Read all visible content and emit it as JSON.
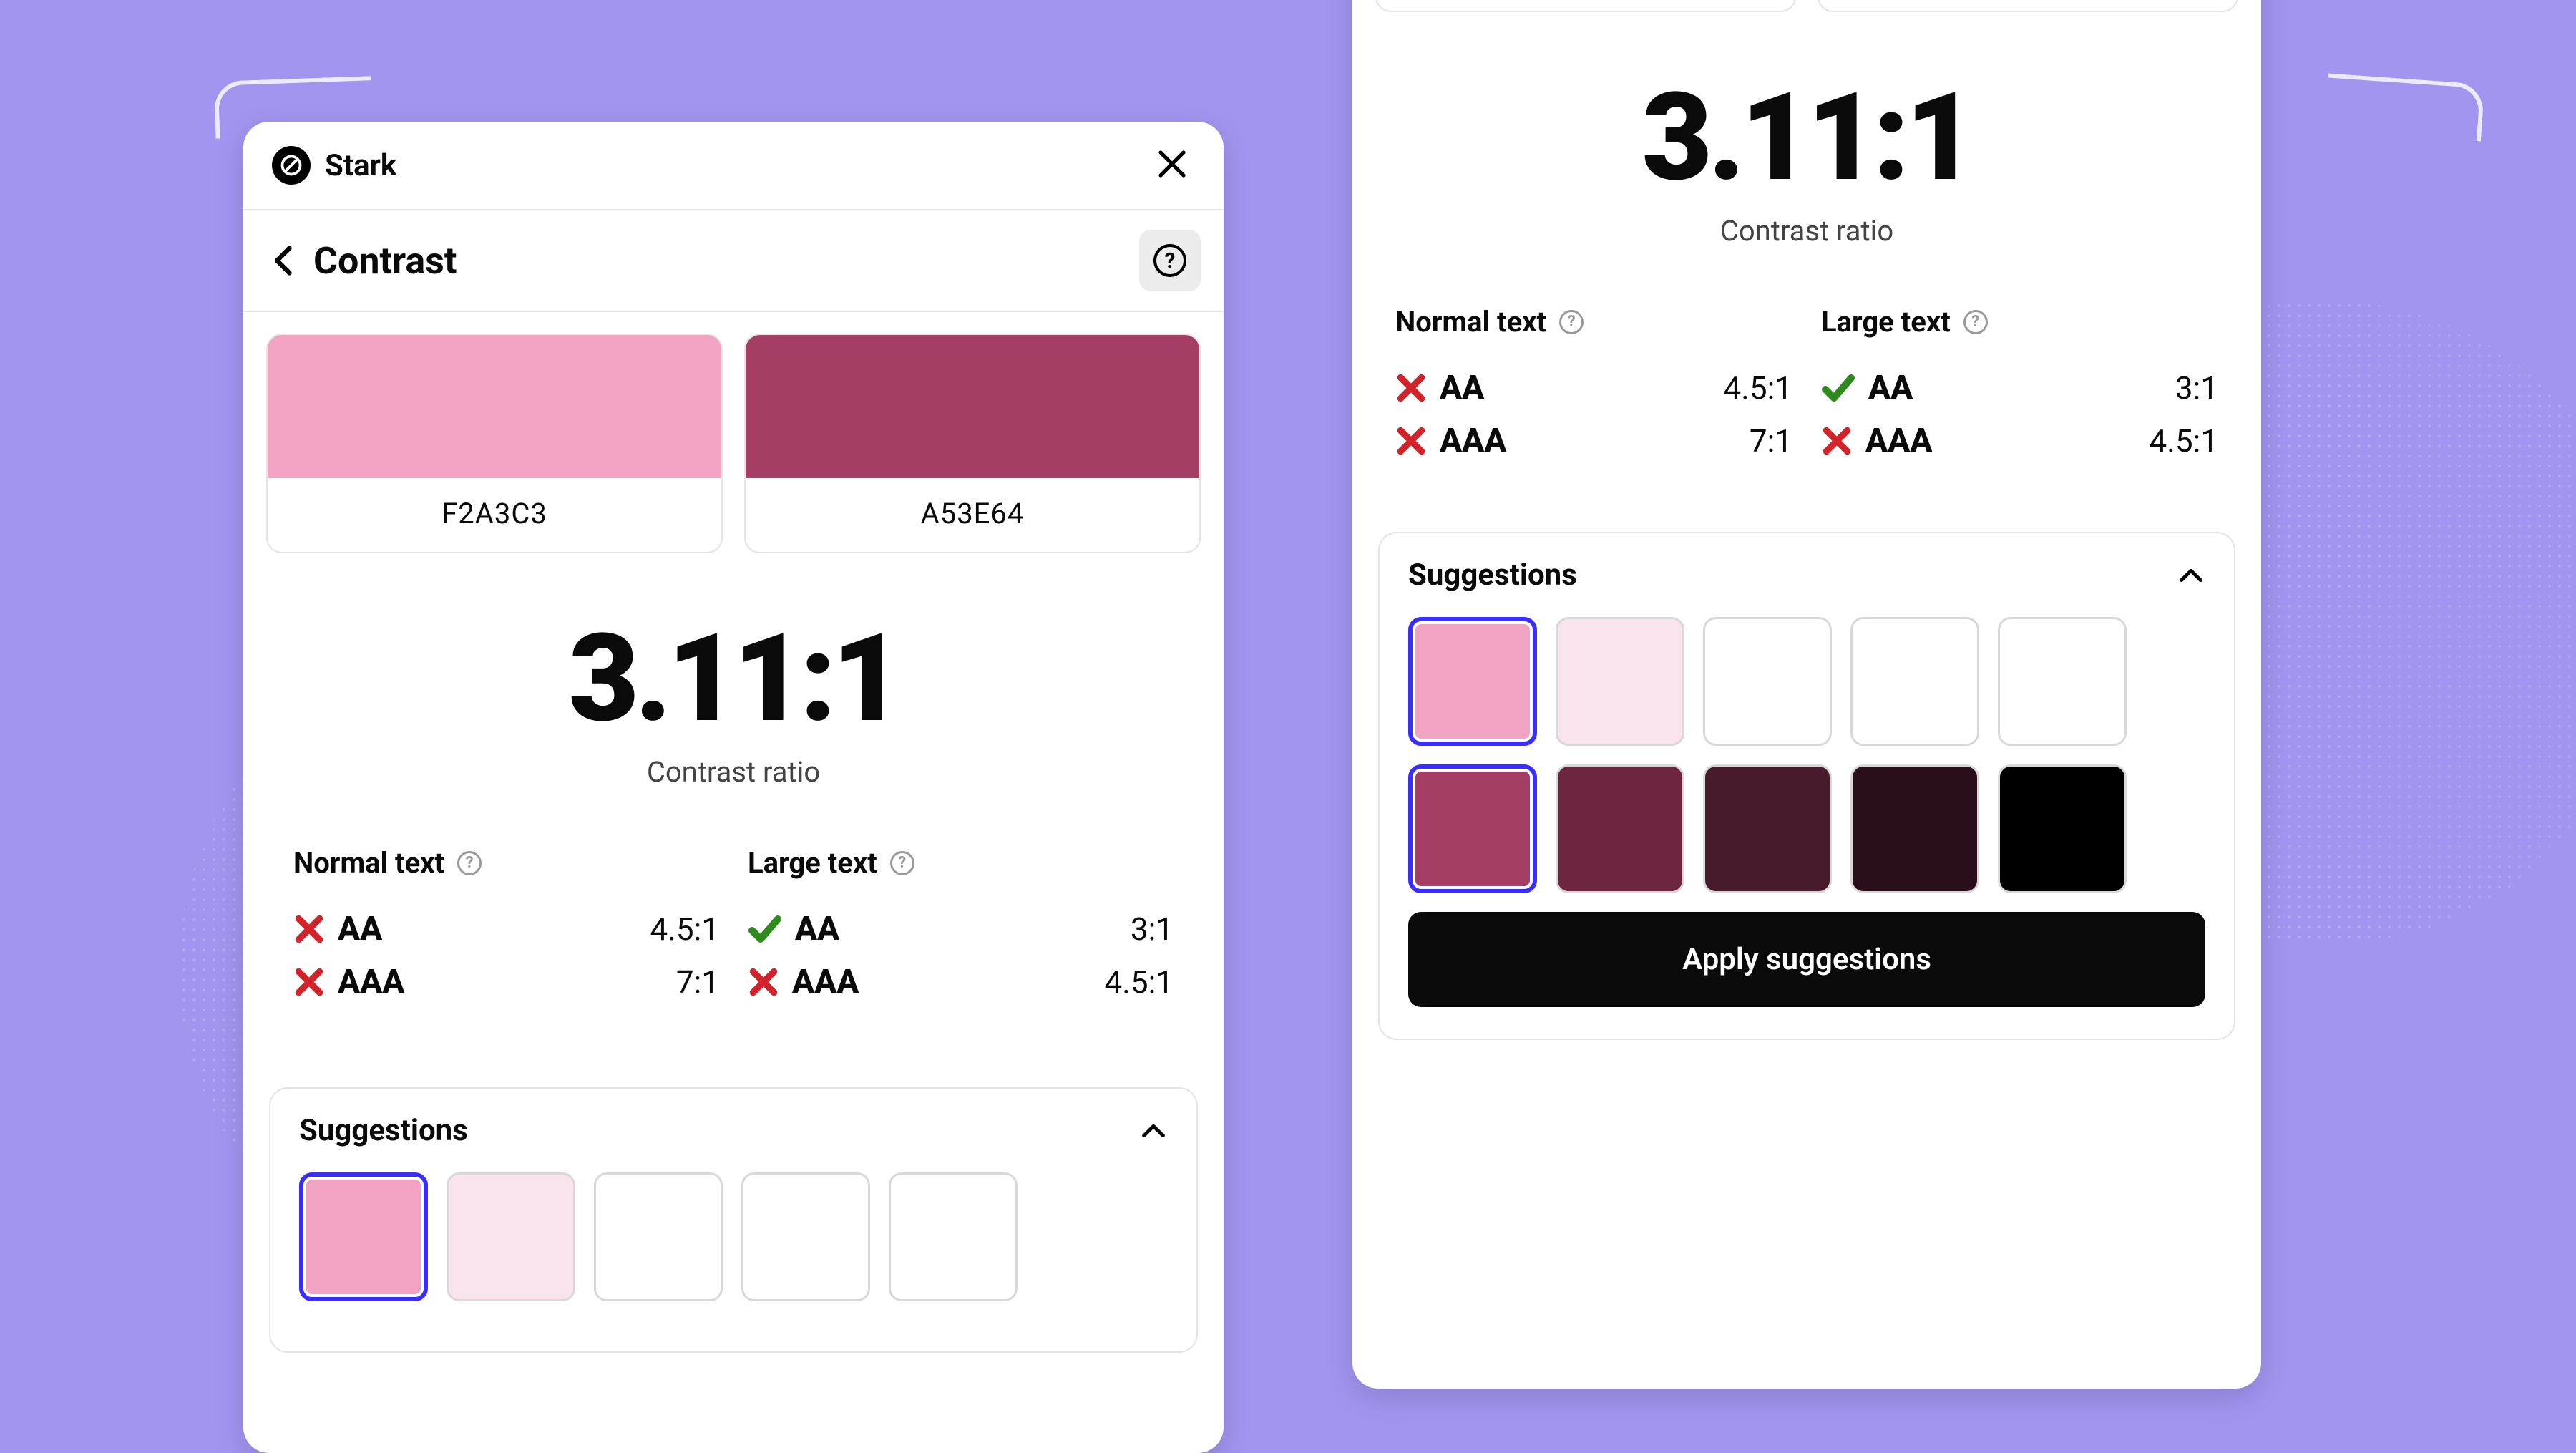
{
  "background_color": "#A195F0",
  "brand": {
    "name": "Stark"
  },
  "nav": {
    "title": "Contrast"
  },
  "colors": {
    "fg": {
      "hex": "F2A3C3",
      "css": "#F2A3C3"
    },
    "bg": {
      "hex": "A53E64",
      "css": "#A53E64"
    }
  },
  "ratio": {
    "value": "3.11:1",
    "label": "Contrast ratio"
  },
  "compliance": {
    "normal": {
      "label": "Normal text",
      "aa": {
        "level": "AA",
        "required": "4.5:1",
        "pass": false
      },
      "aaa": {
        "level": "AAA",
        "required": "7:1",
        "pass": false
      }
    },
    "large": {
      "label": "Large text",
      "aa": {
        "level": "AA",
        "required": "3:1",
        "pass": true
      },
      "aaa": {
        "level": "AAA",
        "required": "4.5:1",
        "pass": false
      }
    }
  },
  "suggestions": {
    "label": "Suggestions",
    "apply_label": "Apply suggestions",
    "row1": [
      {
        "css": "#F2A3C3",
        "selected": true
      },
      {
        "css": "#F9E4EE",
        "selected": false
      },
      {
        "css": "#FFFFFF",
        "selected": false
      },
      {
        "css": "#FFFFFF",
        "selected": false
      },
      {
        "css": "#FFFFFF",
        "selected": false
      }
    ],
    "row2": [
      {
        "css": "#A53E64",
        "selected": true
      },
      {
        "css": "#6E2640",
        "selected": false
      },
      {
        "css": "#471A2E",
        "selected": false
      },
      {
        "css": "#2B0E1B",
        "selected": false
      },
      {
        "css": "#000000",
        "selected": false
      }
    ]
  },
  "status_colors": {
    "fail": "#D3232A",
    "pass": "#2E8A1C",
    "select": "#3A2EFF"
  }
}
